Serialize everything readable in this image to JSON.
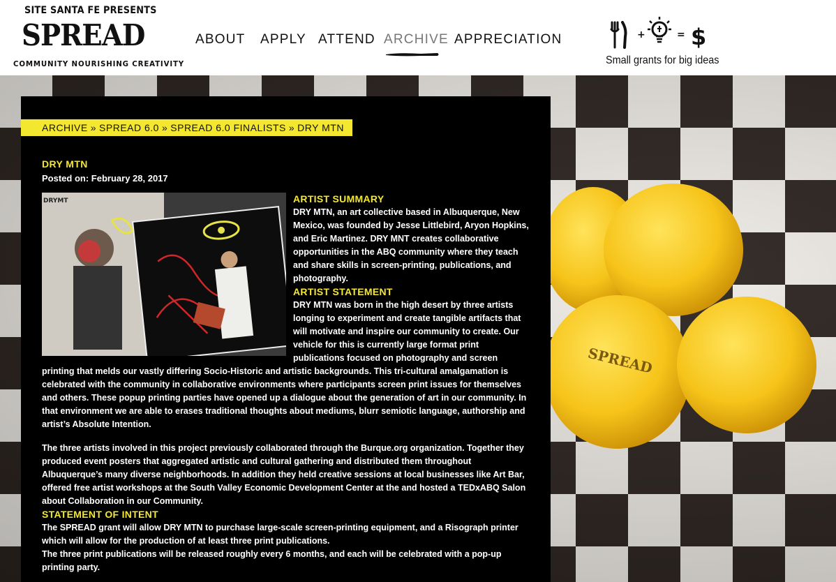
{
  "site": {
    "presents": "SITE SANTA FE PRESENTS",
    "name": "SPREAD",
    "tagline": "COMMUNITY NOURISHING CREATIVITY"
  },
  "nav": {
    "items": [
      {
        "label": "ABOUT",
        "active": false
      },
      {
        "label": "APPLY",
        "active": false
      },
      {
        "label": "ATTEND",
        "active": false
      },
      {
        "label": "ARCHIVE",
        "active": true
      },
      {
        "label": "APPRECIATION",
        "active": false
      }
    ]
  },
  "grants": {
    "equation_icons": [
      "fork-knife-icon",
      "plus",
      "lightbulb-icon",
      "equals",
      "dollar-icon"
    ],
    "tagline": "Small grants for big ideas"
  },
  "background": {
    "lemon_stamp": "SPREAD"
  },
  "breadcrumb": {
    "items": [
      "ARCHIVE",
      "SPREAD 6.0",
      "SPREAD 6.0 FINALISTS",
      "DRY MTN"
    ],
    "separator": "»"
  },
  "post": {
    "title": "DRY MTN",
    "posted_label": "Posted on:",
    "posted_date": "February 28, 2017",
    "sections": {
      "summary_heading": "ARTIST SUMMARY",
      "summary_text": "DRY MTN, an art collective based in Albuquerque, New Mexico, was founded by Jesse Littlebird, Aryon Hopkins, and Eric Martinez. DRY MNT creates collaborative opportunities in the ABQ community where they teach and share skills in screen-printing, publications, and photography.",
      "statement_heading": "ARTIST STATEMENT",
      "statement_text": "DRY MTN was born in the high desert by three artists longing to experiment and create tangible artifacts that will motivate and inspire our community to create. Our vehicle for this is currently large format print publications focused on photography and screen printing that melds our vastly differing Socio-Historic and artistic backgrounds. This tri-cultural amalgamation is celebrated with the community in collaborative environments where participants screen print issues for themselves and others. These popup printing parties have opened up a dialogue about the generation of art in our community. In that environment we are able to erases traditional thoughts about mediums, blurr semiotic language, authorship and artist’s Absolute Intention.",
      "collab_text": "The three artists involved in this project previously collaborated through the Burque.org organization. Together they produced event posters that aggregated artistic and cultural gathering and distributed them throughout Albuquerque’s many diverse neighborhoods. In addition they held creative sessions at local businesses like Art Bar, offered free artist workshops at the South Valley Economic Development Center at the and hosted a TEDxABQ Salon about Collaboration in our Community.",
      "intent_heading": "STATEMENT OF INTENT",
      "intent_text_1": "The SPREAD grant will allow DRY MTN to purchase large-scale screen-printing equipment, and a Risograph printer which will allow for the production of at least three print publications.",
      "intent_text_2": "The three print publications will be released roughly every 6 months, and each will be celebrated with a pop-up printing party."
    },
    "image_label": "DRYMT"
  },
  "colors": {
    "accent_yellow": "#f4e72f",
    "panel_black": "#000000",
    "lemon": "#f6c41a"
  }
}
